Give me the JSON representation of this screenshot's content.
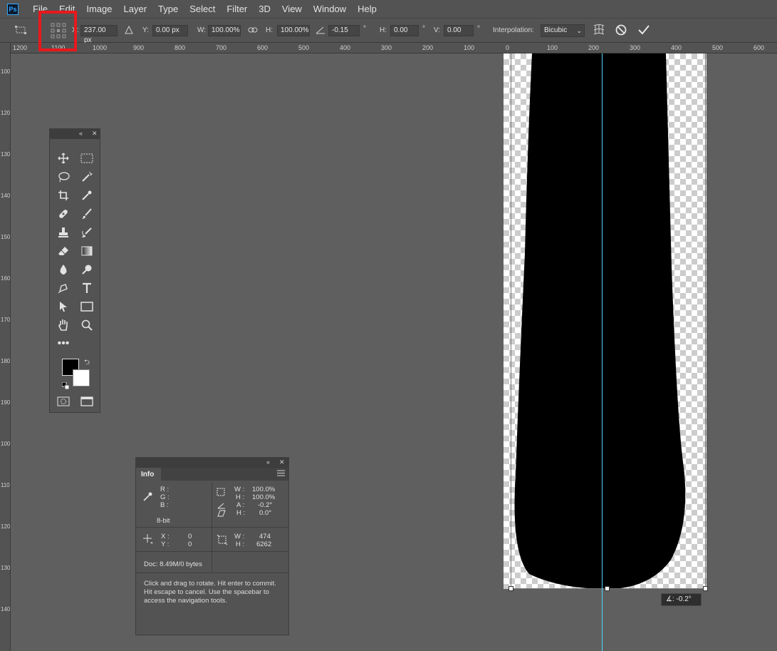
{
  "menubar": {
    "logo": "Ps",
    "items": [
      "File",
      "Edit",
      "Image",
      "Layer",
      "Type",
      "Select",
      "Filter",
      "3D",
      "View",
      "Window",
      "Help"
    ]
  },
  "options": {
    "x_label": "X:",
    "x_value": "237.00 px",
    "y_label": "Y:",
    "y_value": "0.00 px",
    "w_label": "W:",
    "w_value": "100.00%",
    "h_label": "H:",
    "h_value": "100.00%",
    "angle_value": "-0.15",
    "angle_unit": "°",
    "skew_h_label": "H:",
    "skew_h_value": "0.00",
    "skew_h_unit": "°",
    "skew_v_label": "V:",
    "skew_v_value": "0.00",
    "skew_v_unit": "°",
    "interp_label": "Interpolation:",
    "interp_value": "Bicubic"
  },
  "ruler": {
    "h_ticks": [
      "1200",
      "1100",
      "1000",
      "900",
      "800",
      "700",
      "600",
      "500",
      "400",
      "300",
      "200",
      "100",
      "0",
      "100",
      "200",
      "300",
      "400",
      "500",
      "600"
    ],
    "v_ticks": [
      "100",
      "1200",
      "1300",
      "1400",
      "1500",
      "1600",
      "1700",
      "1800",
      "1900",
      "1000",
      "1100",
      "1200",
      "1300",
      "1400",
      "1500"
    ]
  },
  "info": {
    "tab": "Info",
    "r_label": "R :",
    "g_label": "G :",
    "b_label": "B :",
    "bitdepth": "8-bit",
    "w_pct_label": "W :",
    "w_pct": "100.0%",
    "h_pct_label": "H :",
    "h_pct": "100.0%",
    "a_label": "A :",
    "a_val": "-0.2°",
    "h_skew_label": "H :",
    "h_skew": "0.0°",
    "x_label": "X :",
    "x_val": "0",
    "y_label": "Y :",
    "y_val": "0",
    "size_w_label": "W :",
    "size_w": "474",
    "size_h_label": "H :",
    "size_h": "6262",
    "doc": "Doc: 8.49M/0 bytes",
    "hint": "Click and drag to rotate. Hit enter to commit. Hit escape to cancel. Use the spacebar to access the navigation tools."
  },
  "tooltip": {
    "text": "∡: -0.2°"
  }
}
